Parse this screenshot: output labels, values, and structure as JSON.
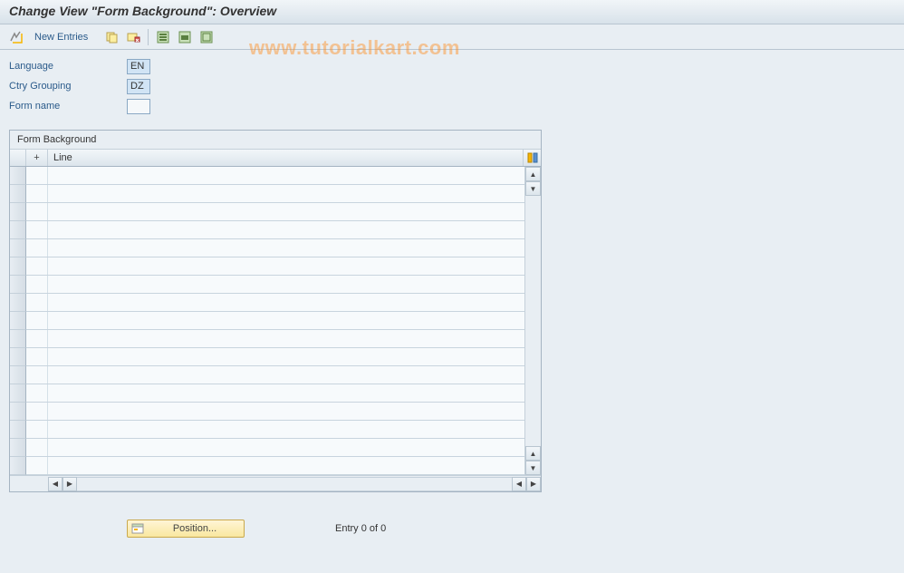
{
  "title": "Change View \"Form Background\": Overview",
  "toolbar": {
    "new_entries_label": "New Entries"
  },
  "watermark": "www.tutorialkart.com",
  "fields": {
    "language_label": "Language",
    "language_value": "EN",
    "ctry_label": "Ctry Grouping",
    "ctry_value": "DZ",
    "formname_label": "Form name",
    "formname_value": ""
  },
  "table": {
    "caption": "Form Background",
    "col_plus": "+",
    "col_line": "Line",
    "row_count": 17
  },
  "footer": {
    "position_label": "Position...",
    "entry_text": "Entry 0 of 0"
  }
}
